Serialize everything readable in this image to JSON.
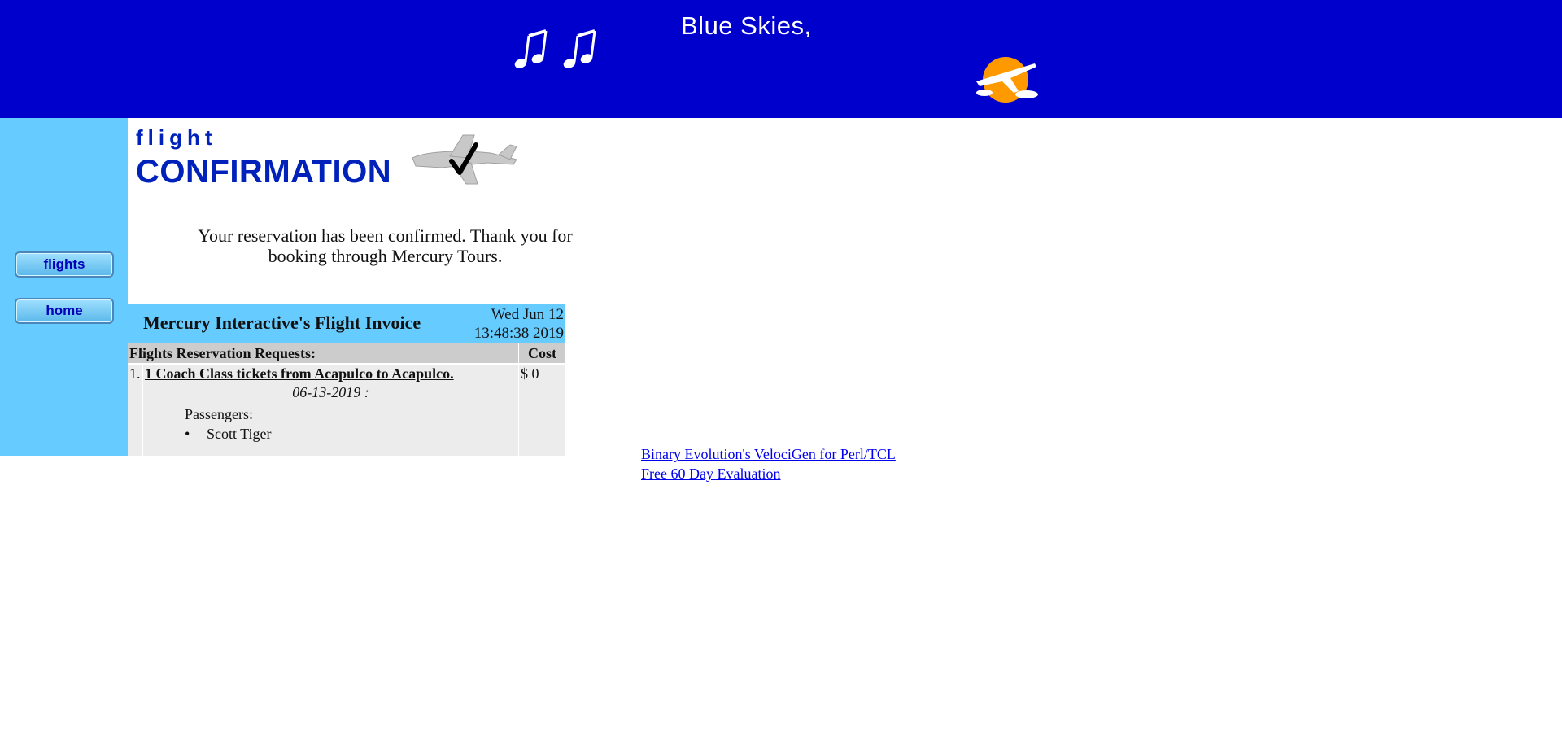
{
  "banner": {
    "title": "Blue Skies,",
    "notes_icon": "music-notes-icon",
    "sun_icon": "sun-airplane-icon",
    "bg_color": "#0000cc"
  },
  "sidebar": {
    "bg_color": "#66ccff",
    "items": [
      {
        "label": "flights"
      },
      {
        "label": "home"
      }
    ]
  },
  "heading": {
    "line1": "flight",
    "line2": "CONFIRMATION",
    "icon": "airplane-checkmark-icon"
  },
  "message": "Your reservation has been confirmed. Thank you for booking through Mercury Tours.",
  "invoice": {
    "title": "Mercury Interactive's Flight Invoice",
    "date": "Wed Jun 12 13:48:38 2019",
    "col_requests": "Flights Reservation Requests:",
    "col_cost": "Cost",
    "rows": [
      {
        "num": "1.",
        "description": "1 Coach Class tickets from Acapulco to Acapulco.",
        "date": "06-13-2019 :",
        "passengers_label": "Passengers:",
        "passengers": [
          "Scott Tiger"
        ],
        "cost": "$ 0"
      }
    ]
  },
  "links": [
    {
      "text": "Binary Evolution's VelociGen for Perl/TCL"
    },
    {
      "text": "Free 60 Day Evaluation"
    }
  ]
}
